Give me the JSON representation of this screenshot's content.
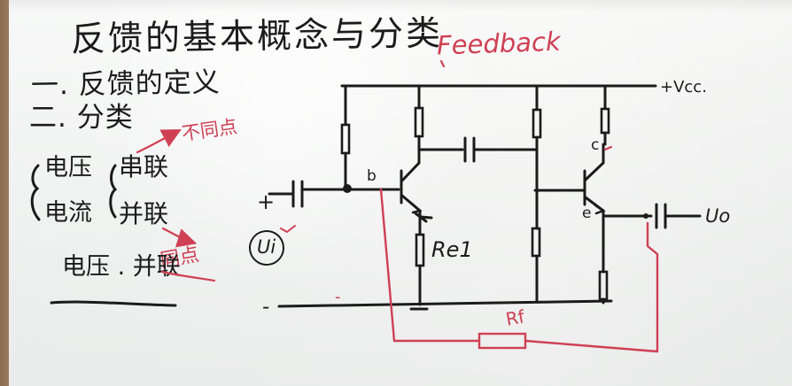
{
  "board": {
    "title_cn": "反馈的基本概念与分类",
    "title_en": "Feedback",
    "item_1": "一. 反馈的定义",
    "item_2": "二. 分类",
    "left_group": {
      "voltage": "电压",
      "current": "电流",
      "series": "串联",
      "parallel": "并联",
      "different_point": "不同点",
      "same_point": "同点",
      "combination": "电压 . 并联"
    },
    "circuit_labels": {
      "vcc": "+Vcc.",
      "b": "b",
      "c": "c",
      "e": "e",
      "uo": "Uo",
      "ui": "Ui",
      "re": "Re1",
      "rf": "Rf",
      "plus": "+",
      "minus": "-",
      "minus_mid": "-"
    }
  },
  "colors": {
    "board": "#f3f3f1",
    "marker_black": "#1b1b1b",
    "marker_red": "#cf4054"
  }
}
